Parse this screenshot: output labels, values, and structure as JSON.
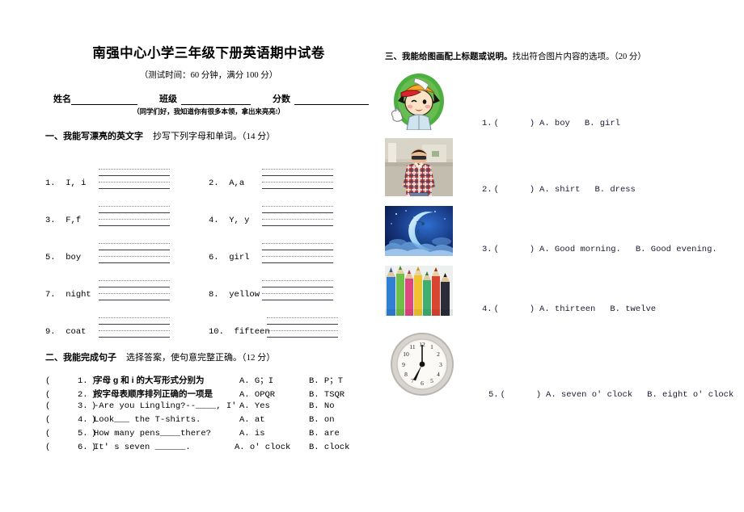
{
  "document": {
    "title": "南强中心小学三年级下册英语期中试卷",
    "subtitle": "（测试时间：60 分钟，满分 100 分）",
    "encouragement": "（同学们好，我知道你有很多本领，拿出来亮亮!）"
  },
  "id_fields": {
    "name_label": "姓名",
    "class_label": "班级",
    "score_label": "分数"
  },
  "section_one": {
    "number": "一、",
    "heading": "我能写漂亮的英文字",
    "note": "抄写下列字母和单词。（14 分）",
    "items": [
      {
        "num": "1.",
        "text": "I, i"
      },
      {
        "num": "2.",
        "text": "A,a"
      },
      {
        "num": "3.",
        "text": "F,f"
      },
      {
        "num": "4.",
        "text": "Y, y"
      },
      {
        "num": "5.",
        "text": "boy"
      },
      {
        "num": "6.",
        "text": "girl"
      },
      {
        "num": "7.",
        "text": "night"
      },
      {
        "num": "8.",
        "text": "yellow"
      },
      {
        "num": "9.",
        "text": "coat"
      },
      {
        "num": "10.",
        "text": "fifteen"
      }
    ]
  },
  "section_two": {
    "number": "二、",
    "heading": "我能完成句子",
    "note": "选择答案，使句意完整正确。（12 分）",
    "paren": "(        )",
    "questions": [
      {
        "num": "1.",
        "stem": "字母 g 和 i 的大写形式分别为",
        "cn": true,
        "a": "A.  G；I",
        "b": "B.  P；T"
      },
      {
        "num": "2.",
        "stem": "按字母表顺序排列正确的一项是",
        "cn": true,
        "a": "A.  OPQR",
        "b": "B.  TSQR"
      },
      {
        "num": "3.",
        "stem": "-Are you Lingling?--____, I' m not.",
        "cn": false,
        "a": "A.  Yes",
        "b": "B.  No"
      },
      {
        "num": "4.",
        "stem": "Look___ the T-shirts.",
        "cn": false,
        "a": "A.  at",
        "b": "B.  on"
      },
      {
        "num": "5.",
        "stem": "How many pens____there?",
        "cn": false,
        "a": "A.  is",
        "b": "B.  are"
      },
      {
        "num": "6.",
        "stem": "It' s seven ______.",
        "cn": false,
        "a": "A.  o' clock",
        "b": "B.  clock"
      }
    ]
  },
  "section_three": {
    "number": "三、",
    "heading": "我能给图画配上标题或说明。",
    "note": "找出符合图片内容的选项。（20 分）",
    "items": [
      {
        "num": "1.",
        "paren": "(      )",
        "option_a": "A.  boy",
        "option_b": "B.  girl",
        "image": "cartoon-boy-thumbs-up-icon"
      },
      {
        "num": "2.",
        "paren": "(      )",
        "option_a": "A.  shirt",
        "option_b": "B.  dress",
        "image": "photo-boy-plaid-shirt-icon"
      },
      {
        "num": "3.",
        "paren": "(      )",
        "option_a": "A.  Good morning.",
        "option_b": "B.  Good evening.",
        "image": "crescent-moon-night-icon"
      },
      {
        "num": "4.",
        "paren": "(      )",
        "option_a": "A.  thirteen",
        "option_b": "B.  twelve",
        "image": "colored-pencils-icon"
      },
      {
        "num": "5.",
        "paren": "(      )",
        "option_a": "A.  seven o' clock",
        "option_b": "B.  eight o' clock",
        "image": "analog-clock-icon"
      }
    ]
  },
  "colors": {
    "paper": "#ffffff",
    "ink": "#000000",
    "option_ink": "#1b1b33",
    "rule_solid": "#3a3a4a",
    "rule_dotted": "#8a8a94",
    "cap_orange": "#f5a623",
    "cap_red": "#d8262c",
    "oval_green": "#4caf3f",
    "moon_blue": "#123a8c",
    "clock_face": "#f4f2ee"
  }
}
